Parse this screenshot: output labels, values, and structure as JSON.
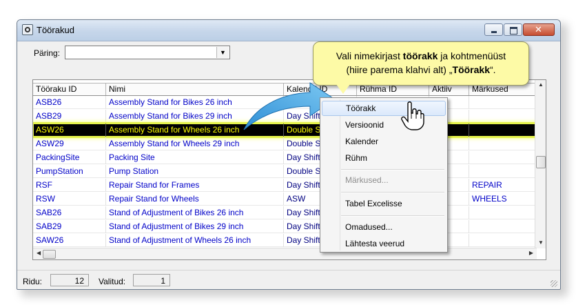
{
  "window": {
    "title": "Töörakud"
  },
  "query": {
    "label": "Päring:",
    "value": "",
    "dropdown_icon": "chevron-down-icon"
  },
  "columns": [
    "Tööraku ID",
    "Nimi",
    "Kalendri ID",
    "Rühma ID",
    "Aktiiv",
    "Märkused"
  ],
  "rows": [
    [
      "ASB26",
      "Assembly Stand for Bikes 26 inch",
      "",
      "",
      "",
      ""
    ],
    [
      "ASB29",
      "Assembly Stand for Bikes 29 inch",
      "Day Shift",
      "",
      "",
      ""
    ],
    [
      "ASW26",
      "Assembly Stand for Wheels 26 inch",
      "Double Shift",
      "",
      "",
      ""
    ],
    [
      "ASW29",
      "Assembly Stand for Wheels 29 inch",
      "Double Shift",
      "",
      "",
      ""
    ],
    [
      "PackingSite",
      "Packing Site",
      "Day Shift",
      "",
      "",
      ""
    ],
    [
      "PumpStation",
      "Pump Station",
      "Double Shift",
      "",
      "",
      ""
    ],
    [
      "RSF",
      "Repair Stand for Frames",
      "Day Shift",
      "",
      "",
      "REPAIR"
    ],
    [
      "RSW",
      "Repair Stand for Wheels",
      "ASW",
      "",
      "",
      "WHEELS"
    ],
    [
      "SAB26",
      "Stand of Adjustment of Bikes 26 inch",
      "Day Shift",
      "",
      "",
      ""
    ],
    [
      "SAB29",
      "Stand of Adjustment of Bikes 29 inch",
      "Day Shift",
      "",
      "",
      ""
    ],
    [
      "SAW26",
      "Stand of Adjustment of Wheels 26 inch",
      "Day Shift",
      "",
      "",
      ""
    ]
  ],
  "selected_row_index": 2,
  "context_menu": {
    "items": [
      {
        "label": "Töörakk",
        "highlighted": true,
        "disabled": false
      },
      {
        "label": "Versioonid",
        "disabled": false
      },
      {
        "label": "Kalender",
        "disabled": false
      },
      {
        "label": "Rühm",
        "disabled": false
      },
      {
        "label": "Märkused...",
        "disabled": true
      },
      {
        "label": "Tabel Excelisse",
        "disabled": false
      },
      {
        "label": "Omadused...",
        "disabled": false
      },
      {
        "label": "Lähtesta veerud",
        "disabled": false
      }
    ]
  },
  "callout": {
    "line1_prefix": "Vali nimekirjast ",
    "line1_bold": "töörakk",
    "line1_suffix": " ja kohtmenüüst",
    "line2_prefix": "(hiire parema klahvi alt) „",
    "line2_bold": "Töörakk",
    "line2_suffix": "“."
  },
  "status": {
    "rows_label": "Ridu:",
    "rows_value": "12",
    "selected_label": "Valitud:",
    "selected_value": "1"
  },
  "colors": {
    "link_text": "#0000c8",
    "selected_row_bg": "#000000",
    "selected_row_text": "#ffff00",
    "selection_glow": "#e4f24a",
    "callout_bg": "#fdfaa6",
    "arrow": "#3aa1e0"
  }
}
